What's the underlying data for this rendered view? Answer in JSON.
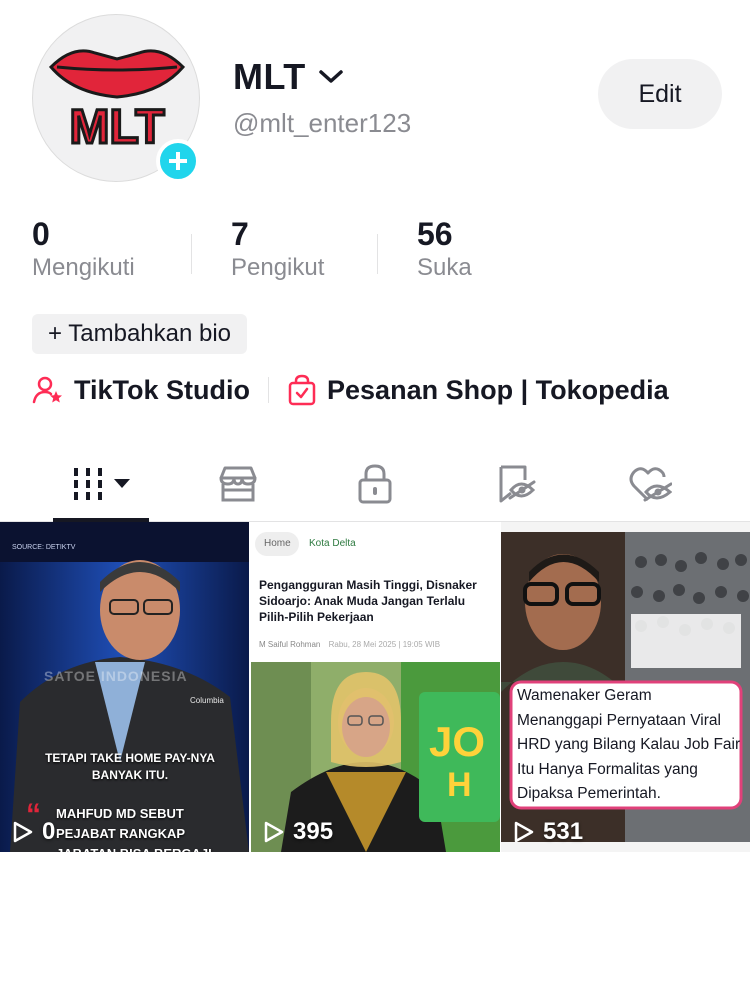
{
  "profile": {
    "display_name": "MLT",
    "username": "@mlt_enter123",
    "avatar_text": "MLT",
    "edit_label": "Edit"
  },
  "stats": [
    {
      "value": "0",
      "label": "Mengikuti"
    },
    {
      "value": "7",
      "label": "Pengikut"
    },
    {
      "value": "56",
      "label": "Suka"
    }
  ],
  "bio_button": "+ Tambahkan bio",
  "links": [
    {
      "label": "TikTok Studio",
      "icon": "user-star-icon"
    },
    {
      "label": "Pesanan Shop | Tokopedia",
      "icon": "shopping-bag-icon"
    }
  ],
  "tabs": [
    {
      "name": "videos",
      "icon": "grid-bars-icon",
      "active": true
    },
    {
      "name": "shop",
      "icon": "shop-icon"
    },
    {
      "name": "private",
      "icon": "lock-icon"
    },
    {
      "name": "favorites",
      "icon": "bookmark-hidden-icon"
    },
    {
      "name": "liked",
      "icon": "heart-hidden-icon"
    }
  ],
  "videos": [
    {
      "views": "0",
      "source_tag": "SOURCE: DETIKTV",
      "watermark": "SATOE INDONESIA",
      "jacket_brand": "Columbia",
      "caption_top": "TETAPI TAKE HOME PAY-NYA BANYAK ITU.",
      "caption_bottom": "MAHFUD MD SEBUT PEJABAT RANGKAP JABATAN BISA BERGAJI MILYARAN PER BULAN"
    },
    {
      "views": "395",
      "breadcrumb_home": "Home",
      "breadcrumb_section": "Kota Delta",
      "headline": "Pengangguran Masih Tinggi, Disnaker Sidoarjo: Anak Muda Jangan Terlalu Pilih-Pilih Pekerjaan",
      "byline": "M Saiful Rohman",
      "date": "Rabu, 28 Mei 2025 | 19:05 WIB",
      "banner_text": "JO",
      "banner_sub": "H"
    },
    {
      "views": "531",
      "caption": "Wamenaker Geram Menanggapi Pernyataan Viral HRD yang Bilang Kalau Job Fair Itu Hanya Formalitas yang Dipaksa Pemerintah."
    }
  ],
  "colors": {
    "accent_cyan": "#20d5ec",
    "brand_red": "#e1253a",
    "text_primary": "#161823",
    "text_secondary": "#8a8b91",
    "chip_bg": "#f1f1f2"
  }
}
